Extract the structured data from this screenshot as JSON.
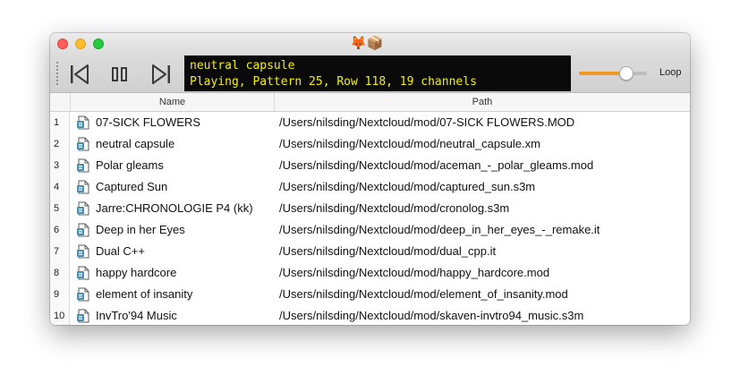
{
  "window": {
    "title": "🦊📦"
  },
  "toolbar": {
    "lcd_line1": "neutral capsule",
    "lcd_line2": "Playing, Pattern 25, Row 118, 19 channels",
    "volume": 0.7,
    "loop_label": "Loop",
    "accent_color": "#f29a23",
    "lcd_text_color": "#f4f100",
    "icons": [
      "previous-track-icon",
      "pause-icon",
      "next-track-icon"
    ]
  },
  "table": {
    "columns": [
      "",
      "Name",
      "Path"
    ],
    "rows": [
      {
        "num": "1",
        "name": "07-SICK FLOWERS",
        "path": "/Users/nilsding/Nextcloud/mod/07-SICK FLOWERS.MOD"
      },
      {
        "num": "2",
        "name": "neutral capsule",
        "path": "/Users/nilsding/Nextcloud/mod/neutral_capsule.xm"
      },
      {
        "num": "3",
        "name": "Polar gleams",
        "path": "/Users/nilsding/Nextcloud/mod/aceman_-_polar_gleams.mod"
      },
      {
        "num": "4",
        "name": "Captured Sun",
        "path": "/Users/nilsding/Nextcloud/mod/captured_sun.s3m"
      },
      {
        "num": "5",
        "name": "Jarre:CHRONOLOGIE P4 (kk)",
        "path": "/Users/nilsding/Nextcloud/mod/cronolog.s3m"
      },
      {
        "num": "6",
        "name": "Deep in her Eyes",
        "path": "/Users/nilsding/Nextcloud/mod/deep_in_her_eyes_-_remake.it"
      },
      {
        "num": "7",
        "name": "Dual C++",
        "path": "/Users/nilsding/Nextcloud/mod/dual_cpp.it"
      },
      {
        "num": "8",
        "name": "happy hardcore",
        "path": "/Users/nilsding/Nextcloud/mod/happy_hardcore.mod"
      },
      {
        "num": "9",
        "name": "element of insanity",
        "path": "/Users/nilsding/Nextcloud/mod/element_of_insanity.mod"
      },
      {
        "num": "10",
        "name": "InvTro'94 Music",
        "path": "/Users/nilsding/Nextcloud/mod/skaven-invtro94_music.s3m"
      }
    ]
  }
}
